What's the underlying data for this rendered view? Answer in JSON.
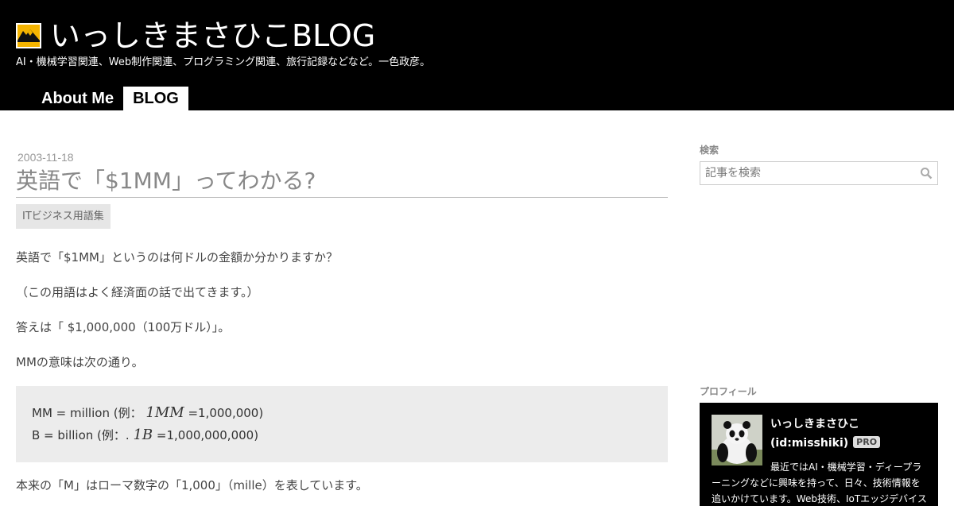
{
  "header": {
    "title": "いっしきまさひこBLOG",
    "description": "AI・機械学習関連、Web制作関連、プログラミング関連、旅行記録などなど。一色政彦。",
    "nav": [
      {
        "label": "About Me",
        "active": false
      },
      {
        "label": "BLOG",
        "active": true
      }
    ]
  },
  "entry": {
    "date": "2003-11-18",
    "title": "英語で「$1MM」ってわかる?",
    "category": "ITビジネス用語集",
    "paragraphs": [
      "英語で「$1MM」というのは何ドルの金額か分かりますか？",
      "（この用語はよく経済面の話で出てきます。）",
      "答えは「 $1,000,000（100万ドル）」。",
      "MMの意味は次の通り。"
    ],
    "quote": {
      "line1_prefix": "MM = million (例： ",
      "line1_math": "1MM",
      "line1_suffix": " =1,000,000)",
      "line2_prefix": "B = billion (例：. ",
      "line2_math": "1B",
      "line2_suffix": " =1,000,000,000)"
    },
    "after_quote": "本来の「M」はローマ数字の「1,000」（mille）を表しています。"
  },
  "sidebar": {
    "search_label": "検索",
    "search_placeholder": "記事を検索",
    "profile_label": "プロフィール",
    "profile": {
      "name": "いっしきまさひこ",
      "id": "(id:misshiki)",
      "badge": "PRO",
      "description": "最近ではAI・機械学習・ディープラーニングなどに興味を持って、日々、技術情報を追いかけています。Web技術、IoTエッジデバイス"
    }
  },
  "colors": {
    "header_bg": "#000000",
    "header_text": "#ffffff",
    "title_gray": "#888888",
    "quote_bg": "#ececec",
    "logo_yellow": "#f5b400"
  }
}
